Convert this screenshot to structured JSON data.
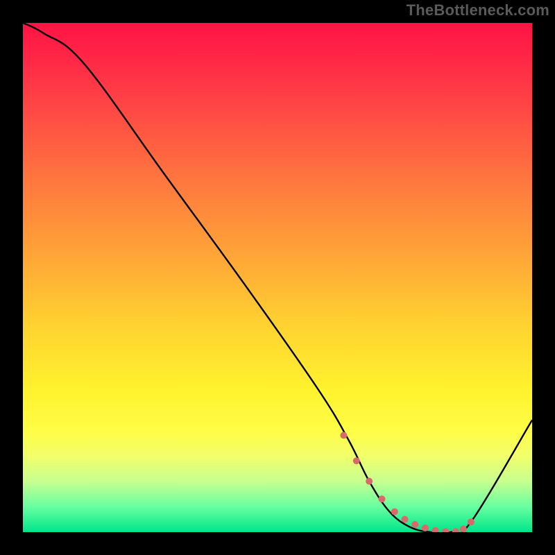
{
  "watermark": "TheBottleneck.com",
  "chart_data": {
    "type": "line",
    "title": "",
    "xlabel": "",
    "ylabel": "",
    "xlim": [
      0,
      100
    ],
    "ylim": [
      0,
      100
    ],
    "series": [
      {
        "name": "bottleneck-curve",
        "x": [
          0,
          4,
          12,
          28,
          44,
          58,
          64,
          68,
          72,
          76,
          80,
          84,
          88,
          100
        ],
        "values": [
          100,
          98,
          92,
          70,
          48,
          28,
          18,
          10,
          4,
          1,
          0,
          0,
          2,
          22
        ]
      }
    ],
    "markers": {
      "name": "highlight-dots",
      "x": [
        63,
        65.5,
        68,
        70.5,
        73,
        75,
        77,
        79,
        81,
        83,
        85,
        86.5,
        88
      ],
      "values": [
        19,
        14,
        10,
        6.5,
        4,
        2.5,
        1.5,
        0.8,
        0.3,
        0.1,
        0.1,
        0.6,
        2
      ],
      "color": "#d76a6a",
      "radius": 5
    },
    "gradient_stops": [
      {
        "offset": 0,
        "color": "#ff1344"
      },
      {
        "offset": 8,
        "color": "#ff2a46"
      },
      {
        "offset": 18,
        "color": "#ff4b44"
      },
      {
        "offset": 32,
        "color": "#ff7a3e"
      },
      {
        "offset": 46,
        "color": "#ffa637"
      },
      {
        "offset": 60,
        "color": "#ffd430"
      },
      {
        "offset": 72,
        "color": "#fff22e"
      },
      {
        "offset": 80,
        "color": "#fffd45"
      },
      {
        "offset": 85,
        "color": "#f2ff6a"
      },
      {
        "offset": 90,
        "color": "#c8ff8f"
      },
      {
        "offset": 95,
        "color": "#68ffa0"
      },
      {
        "offset": 100,
        "color": "#00e58b"
      }
    ]
  }
}
